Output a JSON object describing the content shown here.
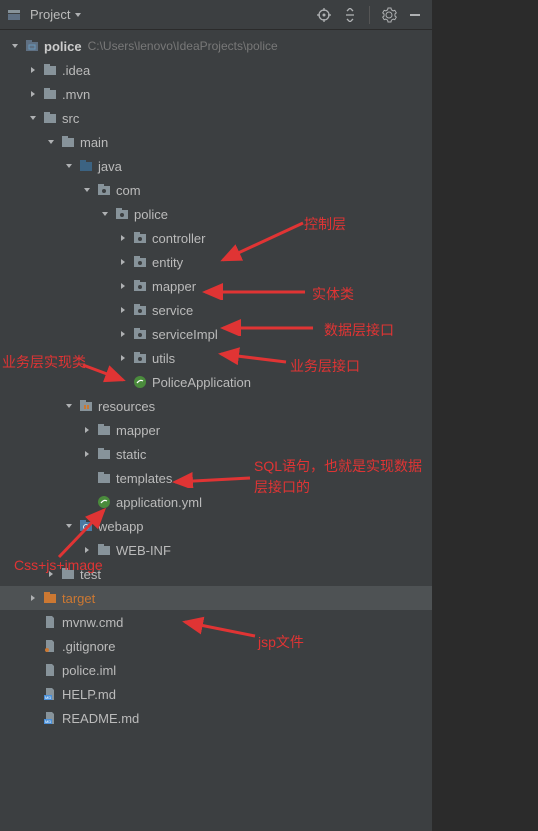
{
  "toolbar": {
    "title": "Project"
  },
  "root": {
    "name": "police",
    "path": "C:\\Users\\lenovo\\IdeaProjects\\police"
  },
  "tree": {
    "idea": ".idea",
    "mvn": ".mvn",
    "src": "src",
    "main": "main",
    "java": "java",
    "com": "com",
    "police": "police",
    "controller": "controller",
    "entity": "entity",
    "mapper": "mapper",
    "service": "service",
    "serviceImpl": "serviceImpl",
    "utils": "utils",
    "policeApp": "PoliceApplication",
    "resources": "resources",
    "resMapper": "mapper",
    "static": "static",
    "templates": "templates",
    "appYml": "application.yml",
    "webapp": "webapp",
    "webinf": "WEB-INF",
    "test": "test",
    "target": "target",
    "mvnw": "mvnw.cmd",
    "gitignore": ".gitignore",
    "policeIml": "police.iml",
    "help": "HELP.md",
    "readme": "README.md"
  },
  "annotations": {
    "controller": "控制层",
    "entity": "实体类",
    "mapper": "数据层接口",
    "service": "业务层接口",
    "serviceImpl": "业务层实现类",
    "sql": "SQL语句，也就是实现数据层接口的",
    "css": "Css+js+image",
    "jsp": "jsp文件"
  }
}
